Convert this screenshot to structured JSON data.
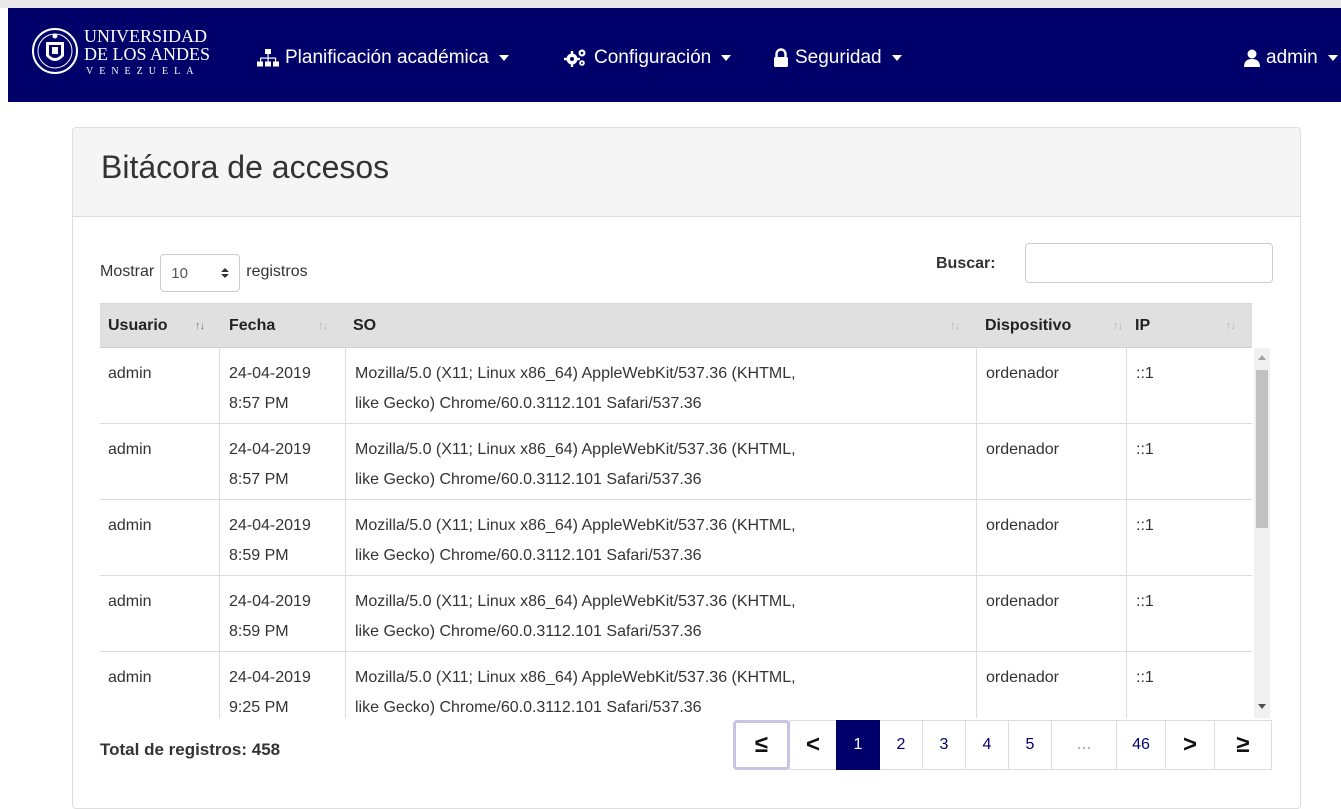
{
  "logo": {
    "line1": "UNIVERSIDAD",
    "line2": "DE LOS ANDES",
    "line3": "VENEZUELA"
  },
  "nav": {
    "planificacion": "Planificación académica",
    "configuracion": "Configuración",
    "seguridad": "Seguridad",
    "user": "admin"
  },
  "panel": {
    "title": "Bitácora de accesos"
  },
  "controls": {
    "show_label": "Mostrar",
    "length_value": "10",
    "records_label": "registros",
    "search_label": "Buscar:",
    "search_value": ""
  },
  "table": {
    "headers": [
      "Usuario",
      "Fecha",
      "SO",
      "Dispositivo",
      "IP"
    ],
    "rows": [
      {
        "usuario": "admin",
        "fecha1": "24-04-2019",
        "fecha2": "8:57 PM",
        "so1": "Mozilla/5.0 (X11; Linux x86_64) AppleWebKit/537.36 (KHTML,",
        "so2": "like Gecko) Chrome/60.0.3112.101 Safari/537.36",
        "dispositivo": "ordenador",
        "ip": "::1"
      },
      {
        "usuario": "admin",
        "fecha1": "24-04-2019",
        "fecha2": "8:57 PM",
        "so1": "Mozilla/5.0 (X11; Linux x86_64) AppleWebKit/537.36 (KHTML,",
        "so2": "like Gecko) Chrome/60.0.3112.101 Safari/537.36",
        "dispositivo": "ordenador",
        "ip": "::1"
      },
      {
        "usuario": "admin",
        "fecha1": "24-04-2019",
        "fecha2": "8:59 PM",
        "so1": "Mozilla/5.0 (X11; Linux x86_64) AppleWebKit/537.36 (KHTML,",
        "so2": "like Gecko) Chrome/60.0.3112.101 Safari/537.36",
        "dispositivo": "ordenador",
        "ip": "::1"
      },
      {
        "usuario": "admin",
        "fecha1": "24-04-2019",
        "fecha2": "8:59 PM",
        "so1": "Mozilla/5.0 (X11; Linux x86_64) AppleWebKit/537.36 (KHTML,",
        "so2": "like Gecko) Chrome/60.0.3112.101 Safari/537.36",
        "dispositivo": "ordenador",
        "ip": "::1"
      },
      {
        "usuario": "admin",
        "fecha1": "24-04-2019",
        "fecha2": "9:25 PM",
        "so1": "Mozilla/5.0 (X11; Linux x86_64) AppleWebKit/537.36 (KHTML,",
        "so2": "like Gecko) Chrome/60.0.3112.101 Safari/537.36",
        "dispositivo": "ordenador",
        "ip": "::1"
      }
    ]
  },
  "footer": {
    "total": "Total de registros: 458"
  },
  "pagination": {
    "first": "≤",
    "prev": "<",
    "pages": [
      "1",
      "2",
      "3",
      "4",
      "5",
      "…",
      "46"
    ],
    "next": ">",
    "last": "≥",
    "current": "1"
  },
  "colors": {
    "navbar": "#00006b",
    "active_page": "#00006b",
    "panel_header": "#f5f5f5",
    "table_header": "#e0e0e0"
  }
}
